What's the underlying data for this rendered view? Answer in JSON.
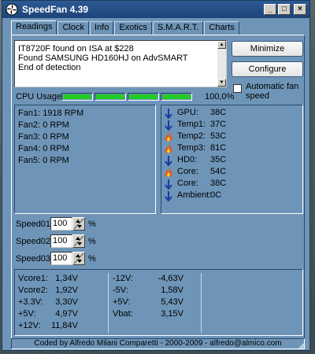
{
  "window": {
    "title": "SpeedFan 4.39"
  },
  "titlebar": {
    "minimize_glyph": "_",
    "maximize_glyph": "□",
    "close_glyph": "×"
  },
  "tabs": [
    {
      "label": "Readings",
      "active": true
    },
    {
      "label": "Clock"
    },
    {
      "label": "Info"
    },
    {
      "label": "Exotics"
    },
    {
      "label": "S.M.A.R.T."
    },
    {
      "label": "Charts"
    }
  ],
  "log": {
    "lines": [
      "IT8720F found on ISA at $228",
      "Found SAMSUNG HD160HJ on AdvSMART",
      "End of detection"
    ]
  },
  "buttons": {
    "minimize": "Minimize",
    "configure": "Configure"
  },
  "auto_fan": {
    "label": "Automatic fan speed",
    "checked": false
  },
  "cpu": {
    "label": "CPU Usage",
    "percent_text": "100,0%",
    "bar_fill_fraction": 1.0,
    "bar_color": "#22cc22"
  },
  "fans": [
    {
      "name": "Fan1:",
      "value": "1918 RPM"
    },
    {
      "name": "Fan2:",
      "value": "0 RPM"
    },
    {
      "name": "Fan3:",
      "value": "0 RPM"
    },
    {
      "name": "Fan4:",
      "value": "0 RPM"
    },
    {
      "name": "Fan5:",
      "value": "0 RPM"
    }
  ],
  "temps": [
    {
      "name": "GPU:",
      "value": "38C",
      "icon": "arrow-down-icon"
    },
    {
      "name": "Temp1:",
      "value": "37C",
      "icon": "arrow-down-icon"
    },
    {
      "name": "Temp2:",
      "value": "53C",
      "icon": "flame-icon"
    },
    {
      "name": "Temp3:",
      "value": "81C",
      "icon": "flame-icon"
    },
    {
      "name": "HD0:",
      "value": "35C",
      "icon": "arrow-down-icon"
    },
    {
      "name": "Core:",
      "value": "54C",
      "icon": "flame-icon"
    },
    {
      "name": "Core:",
      "value": "38C",
      "icon": "arrow-down-icon"
    },
    {
      "name": "Ambient:",
      "value": "0C",
      "icon": "arrow-down-icon"
    }
  ],
  "speeds": [
    {
      "label": "Speed01:",
      "value": "100",
      "unit": "%"
    },
    {
      "label": "Speed02:",
      "value": "100",
      "unit": "%"
    },
    {
      "label": "Speed03:",
      "value": "100",
      "unit": "%"
    }
  ],
  "voltages_left": [
    {
      "name": "Vcore1:",
      "value": "1,34V"
    },
    {
      "name": "Vcore2:",
      "value": "1,92V"
    },
    {
      "name": "+3.3V:",
      "value": "3,30V"
    },
    {
      "name": "+5V:",
      "value": "4,97V"
    },
    {
      "name": "+12V:",
      "value": "11,84V"
    }
  ],
  "voltages_right": [
    {
      "name": "-12V:",
      "value": "-4,63V"
    },
    {
      "name": "-5V:",
      "value": "1,58V"
    },
    {
      "name": "+5V:",
      "value": "5,43V"
    },
    {
      "name": "Vbat:",
      "value": "3,15V"
    }
  ],
  "footer": {
    "text": "Coded by Alfredo Milani Comparetti - 2000-2009 - alfredo@almico.com"
  },
  "colors": {
    "window_bg": "#6e95b8",
    "titlebar": "#1d4478",
    "cold_arrow": "#1a3aa8",
    "flame_outer": "#e65a10",
    "flame_inner": "#ffd23a"
  }
}
